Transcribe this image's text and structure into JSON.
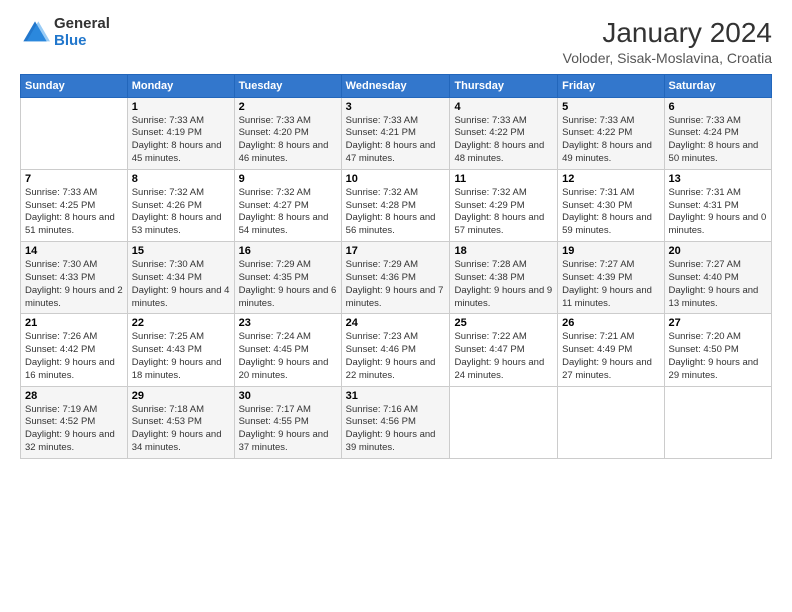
{
  "logo": {
    "general": "General",
    "blue": "Blue"
  },
  "title": "January 2024",
  "subtitle": "Voloder, Sisak-Moslavina, Croatia",
  "headers": [
    "Sunday",
    "Monday",
    "Tuesday",
    "Wednesday",
    "Thursday",
    "Friday",
    "Saturday"
  ],
  "weeks": [
    [
      {
        "num": "",
        "sunrise": "",
        "sunset": "",
        "daylight": ""
      },
      {
        "num": "1",
        "sunrise": "Sunrise: 7:33 AM",
        "sunset": "Sunset: 4:19 PM",
        "daylight": "Daylight: 8 hours and 45 minutes."
      },
      {
        "num": "2",
        "sunrise": "Sunrise: 7:33 AM",
        "sunset": "Sunset: 4:20 PM",
        "daylight": "Daylight: 8 hours and 46 minutes."
      },
      {
        "num": "3",
        "sunrise": "Sunrise: 7:33 AM",
        "sunset": "Sunset: 4:21 PM",
        "daylight": "Daylight: 8 hours and 47 minutes."
      },
      {
        "num": "4",
        "sunrise": "Sunrise: 7:33 AM",
        "sunset": "Sunset: 4:22 PM",
        "daylight": "Daylight: 8 hours and 48 minutes."
      },
      {
        "num": "5",
        "sunrise": "Sunrise: 7:33 AM",
        "sunset": "Sunset: 4:22 PM",
        "daylight": "Daylight: 8 hours and 49 minutes."
      },
      {
        "num": "6",
        "sunrise": "Sunrise: 7:33 AM",
        "sunset": "Sunset: 4:24 PM",
        "daylight": "Daylight: 8 hours and 50 minutes."
      }
    ],
    [
      {
        "num": "7",
        "sunrise": "Sunrise: 7:33 AM",
        "sunset": "Sunset: 4:25 PM",
        "daylight": "Daylight: 8 hours and 51 minutes."
      },
      {
        "num": "8",
        "sunrise": "Sunrise: 7:32 AM",
        "sunset": "Sunset: 4:26 PM",
        "daylight": "Daylight: 8 hours and 53 minutes."
      },
      {
        "num": "9",
        "sunrise": "Sunrise: 7:32 AM",
        "sunset": "Sunset: 4:27 PM",
        "daylight": "Daylight: 8 hours and 54 minutes."
      },
      {
        "num": "10",
        "sunrise": "Sunrise: 7:32 AM",
        "sunset": "Sunset: 4:28 PM",
        "daylight": "Daylight: 8 hours and 56 minutes."
      },
      {
        "num": "11",
        "sunrise": "Sunrise: 7:32 AM",
        "sunset": "Sunset: 4:29 PM",
        "daylight": "Daylight: 8 hours and 57 minutes."
      },
      {
        "num": "12",
        "sunrise": "Sunrise: 7:31 AM",
        "sunset": "Sunset: 4:30 PM",
        "daylight": "Daylight: 8 hours and 59 minutes."
      },
      {
        "num": "13",
        "sunrise": "Sunrise: 7:31 AM",
        "sunset": "Sunset: 4:31 PM",
        "daylight": "Daylight: 9 hours and 0 minutes."
      }
    ],
    [
      {
        "num": "14",
        "sunrise": "Sunrise: 7:30 AM",
        "sunset": "Sunset: 4:33 PM",
        "daylight": "Daylight: 9 hours and 2 minutes."
      },
      {
        "num": "15",
        "sunrise": "Sunrise: 7:30 AM",
        "sunset": "Sunset: 4:34 PM",
        "daylight": "Daylight: 9 hours and 4 minutes."
      },
      {
        "num": "16",
        "sunrise": "Sunrise: 7:29 AM",
        "sunset": "Sunset: 4:35 PM",
        "daylight": "Daylight: 9 hours and 6 minutes."
      },
      {
        "num": "17",
        "sunrise": "Sunrise: 7:29 AM",
        "sunset": "Sunset: 4:36 PM",
        "daylight": "Daylight: 9 hours and 7 minutes."
      },
      {
        "num": "18",
        "sunrise": "Sunrise: 7:28 AM",
        "sunset": "Sunset: 4:38 PM",
        "daylight": "Daylight: 9 hours and 9 minutes."
      },
      {
        "num": "19",
        "sunrise": "Sunrise: 7:27 AM",
        "sunset": "Sunset: 4:39 PM",
        "daylight": "Daylight: 9 hours and 11 minutes."
      },
      {
        "num": "20",
        "sunrise": "Sunrise: 7:27 AM",
        "sunset": "Sunset: 4:40 PM",
        "daylight": "Daylight: 9 hours and 13 minutes."
      }
    ],
    [
      {
        "num": "21",
        "sunrise": "Sunrise: 7:26 AM",
        "sunset": "Sunset: 4:42 PM",
        "daylight": "Daylight: 9 hours and 16 minutes."
      },
      {
        "num": "22",
        "sunrise": "Sunrise: 7:25 AM",
        "sunset": "Sunset: 4:43 PM",
        "daylight": "Daylight: 9 hours and 18 minutes."
      },
      {
        "num": "23",
        "sunrise": "Sunrise: 7:24 AM",
        "sunset": "Sunset: 4:45 PM",
        "daylight": "Daylight: 9 hours and 20 minutes."
      },
      {
        "num": "24",
        "sunrise": "Sunrise: 7:23 AM",
        "sunset": "Sunset: 4:46 PM",
        "daylight": "Daylight: 9 hours and 22 minutes."
      },
      {
        "num": "25",
        "sunrise": "Sunrise: 7:22 AM",
        "sunset": "Sunset: 4:47 PM",
        "daylight": "Daylight: 9 hours and 24 minutes."
      },
      {
        "num": "26",
        "sunrise": "Sunrise: 7:21 AM",
        "sunset": "Sunset: 4:49 PM",
        "daylight": "Daylight: 9 hours and 27 minutes."
      },
      {
        "num": "27",
        "sunrise": "Sunrise: 7:20 AM",
        "sunset": "Sunset: 4:50 PM",
        "daylight": "Daylight: 9 hours and 29 minutes."
      }
    ],
    [
      {
        "num": "28",
        "sunrise": "Sunrise: 7:19 AM",
        "sunset": "Sunset: 4:52 PM",
        "daylight": "Daylight: 9 hours and 32 minutes."
      },
      {
        "num": "29",
        "sunrise": "Sunrise: 7:18 AM",
        "sunset": "Sunset: 4:53 PM",
        "daylight": "Daylight: 9 hours and 34 minutes."
      },
      {
        "num": "30",
        "sunrise": "Sunrise: 7:17 AM",
        "sunset": "Sunset: 4:55 PM",
        "daylight": "Daylight: 9 hours and 37 minutes."
      },
      {
        "num": "31",
        "sunrise": "Sunrise: 7:16 AM",
        "sunset": "Sunset: 4:56 PM",
        "daylight": "Daylight: 9 hours and 39 minutes."
      },
      {
        "num": "",
        "sunrise": "",
        "sunset": "",
        "daylight": ""
      },
      {
        "num": "",
        "sunrise": "",
        "sunset": "",
        "daylight": ""
      },
      {
        "num": "",
        "sunrise": "",
        "sunset": "",
        "daylight": ""
      }
    ]
  ]
}
